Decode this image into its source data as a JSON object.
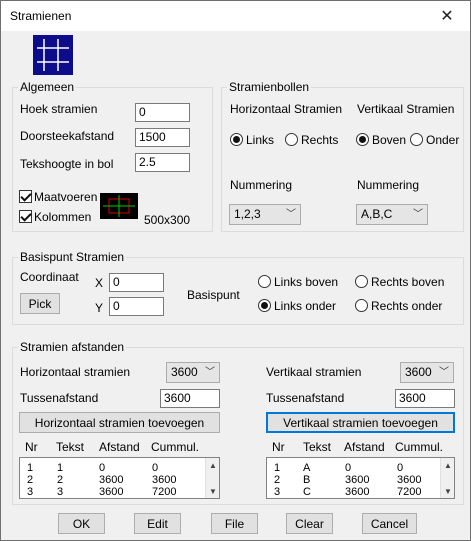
{
  "window": {
    "title": "Stramienen",
    "close_icon": "close-icon"
  },
  "colors": {
    "grid_icon_bg": "#0d0d8c",
    "preview_bg": "#000000",
    "accent": "#0078d7"
  },
  "algemeen": {
    "title": "Algemeen",
    "hoek_label": "Hoek stramien",
    "hoek_value": "0",
    "doorsteek_label": "Doorsteekafstand",
    "doorsteek_value": "1500",
    "tekshoogte_label": "Tekshoogte in bol",
    "tekshoogte_value": "2.5",
    "maatvoeren_label": "Maatvoeren",
    "maatvoeren_checked": true,
    "kolommen_label": "Kolommen",
    "kolommen_checked": true,
    "kolom_size": "500x300"
  },
  "stramienbollen": {
    "title": "Stramienbollen",
    "horizontaal_label": "Horizontaal Stramien",
    "vertikaal_label": "Vertikaal Stramien",
    "links_label": "Links",
    "rechts_label": "Rechts",
    "horizontaal_selected": "Links",
    "boven_label": "Boven",
    "onder_label": "Onder",
    "vertikaal_selected": "Boven",
    "nummering_h_label": "Nummering",
    "nummering_h_value": "1,2,3",
    "nummering_v_label": "Nummering",
    "nummering_v_value": "A,B,C"
  },
  "basispunt": {
    "title": "Basispunt Stramien",
    "coordinaat_label": "Coordinaat",
    "x_label": "X",
    "x_value": "0",
    "y_label": "Y",
    "y_value": "0",
    "pick_label": "Pick",
    "basispunt_label": "Basispunt",
    "links_boven": "Links boven",
    "rechts_boven": "Rechts boven",
    "links_onder": "Links onder",
    "rechts_onder": "Rechts onder",
    "selected": "Links onder"
  },
  "afstanden": {
    "title": "Stramien afstanden",
    "hor_label": "Horizontaal stramien",
    "hor_value": "3600",
    "hor_tussen_label": "Tussenafstand",
    "hor_tussen_value": "3600",
    "hor_add_button": "Horizontaal stramien toevoegen",
    "vert_label": "Vertikaal stramien",
    "vert_value": "3600",
    "vert_tussen_label": "Tussenafstand",
    "vert_tussen_value": "3600",
    "vert_add_button": "Vertikaal stramien toevoegen",
    "columns": [
      "Nr",
      "Tekst",
      "Afstand",
      "Cummul."
    ],
    "hor_rows": [
      [
        "1",
        "1",
        "0",
        "0"
      ],
      [
        "2",
        "2",
        "3600",
        "3600"
      ],
      [
        "3",
        "3",
        "3600",
        "7200"
      ]
    ],
    "vert_rows": [
      [
        "1",
        "A",
        "0",
        "0"
      ],
      [
        "2",
        "B",
        "3600",
        "3600"
      ],
      [
        "3",
        "C",
        "3600",
        "7200"
      ]
    ]
  },
  "footer": {
    "ok": "OK",
    "edit": "Edit",
    "file": "File",
    "clear": "Clear",
    "cancel": "Cancel"
  }
}
